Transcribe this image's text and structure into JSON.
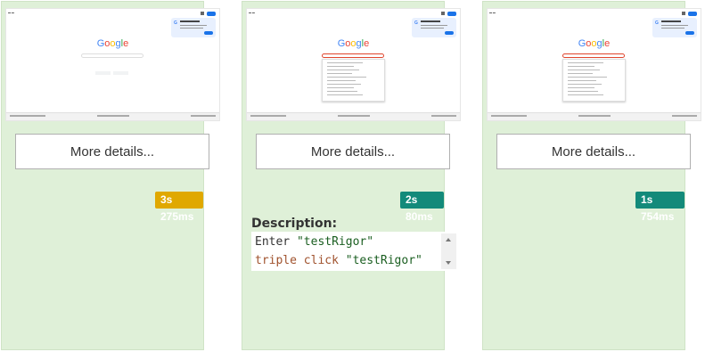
{
  "cards": [
    {
      "logo_text": "Google",
      "details_label": "More details...",
      "duration": "3s 275ms",
      "duration_color": "#e0a800"
    },
    {
      "logo_text": "Google",
      "details_label": "More details...",
      "duration": "2s 80ms",
      "duration_color": "#138a7a",
      "description_label": "Description:",
      "steps": [
        {
          "keyword": "Enter",
          "arg": "\"testRigor\""
        },
        {
          "keyword": "triple click",
          "arg": "\"testRigor\""
        }
      ]
    },
    {
      "logo_text": "Google",
      "details_label": "More details...",
      "duration": "1s 754ms",
      "duration_color": "#138a7a"
    }
  ],
  "colors": {
    "card_bg": "#dff0d8",
    "google_blue": "#4285f4",
    "google_red": "#ea4335",
    "google_yellow": "#fbbc05",
    "google_green": "#34a853"
  },
  "icons": {
    "scroll_up": "triangle-up",
    "scroll_down": "triangle-down"
  }
}
